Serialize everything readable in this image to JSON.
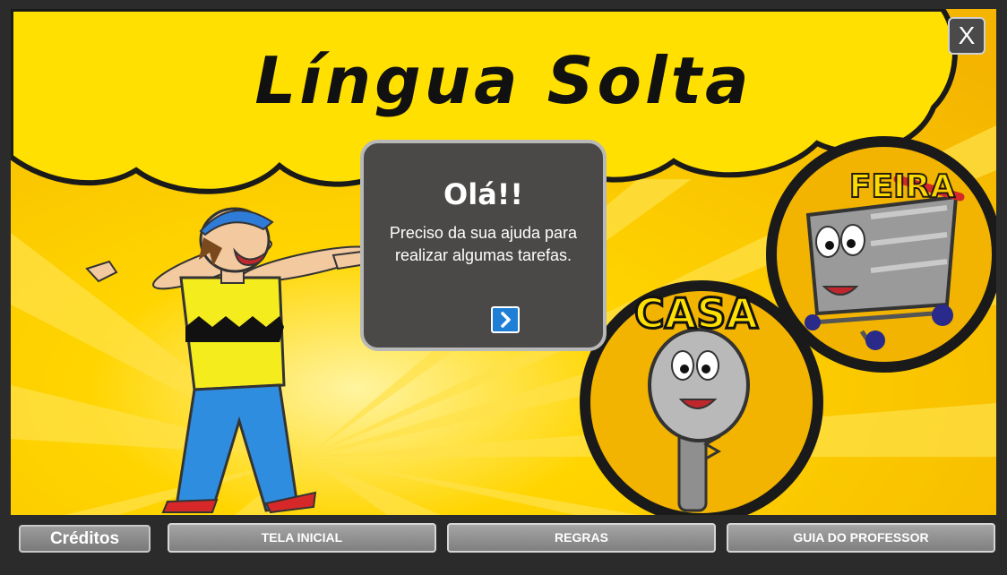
{
  "game": {
    "title": "Língua Solta"
  },
  "window": {
    "close_label": "X"
  },
  "dialog": {
    "greeting": "Olá!!",
    "message": "Preciso da sua ajuda para realizar algumas tarefas.",
    "next_icon": "chevron-right-icon"
  },
  "scene": {
    "key_label": "CASA",
    "cart_label": "FEIRA"
  },
  "bottom_bar": {
    "credits_label": "Créditos",
    "buttons": [
      {
        "label": "TELA INICIAL"
      },
      {
        "label": "REGRAS"
      },
      {
        "label": "GUIA DO PROFESSOR"
      }
    ]
  },
  "colors": {
    "background": "#f7c600",
    "cloud": "#ffe000",
    "bubble": "#4a4948",
    "next_button": "#1f7fd6",
    "bar": "#2b2b2b"
  }
}
